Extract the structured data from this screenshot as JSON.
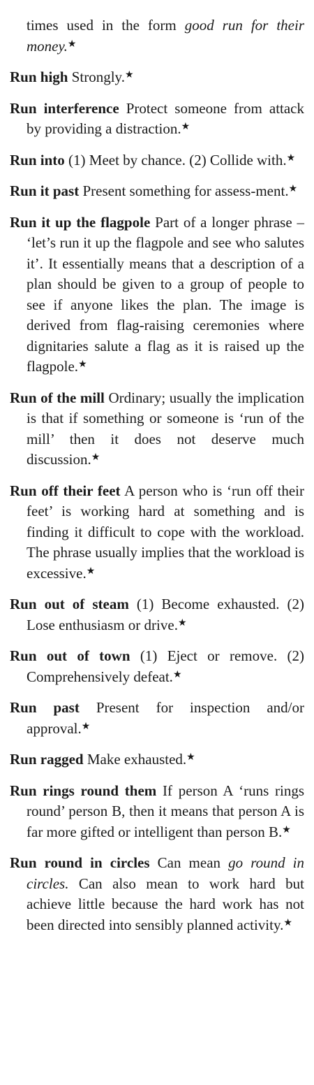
{
  "page": {
    "star": "★",
    "continuation": {
      "pre": "",
      "em": "times used in the form good run for their money.",
      "post": ""
    },
    "entries": [
      {
        "term": "Run high",
        "def": "Strongly."
      },
      {
        "term": "Run interference",
        "def": "Protect someone from attack by providing a distraction."
      },
      {
        "term": "Run into",
        "def": "(1) Meet by chance. (2) Collide with."
      },
      {
        "term": "Run it past",
        "def": "Present something for assess-ment."
      },
      {
        "term": "Run it up the flagpole",
        "def": "Part of a longer phrase – ‘let’s run it up the flagpole and see who salutes it’. It essentially means that a description of a plan should be given to a group of people to see if anyone likes the plan. The image is derived from flag-raising ceremonies where dignitaries salute a flag as it is raised up the flagpole."
      },
      {
        "term": "Run of the mill",
        "def": "Ordinary; usually the implication is that if something or someone is ‘run of the mill’ then it does not deserve much discussion."
      },
      {
        "term": "Run off their feet",
        "def": "A person who is ‘run off their feet’ is working hard at something and is finding it difficult to cope with the workload. The phrase usually implies that the workload is excessive."
      },
      {
        "term": "Run out of steam",
        "def": "(1) Become exhausted. (2) Lose enthusiasm or drive."
      },
      {
        "term": "Run out of town",
        "def": "(1) Eject or remove. (2) Comprehensively defeat."
      },
      {
        "term": "Run past",
        "def": "Present for inspection and/or approval."
      },
      {
        "term": "Run ragged",
        "def": "Make exhausted."
      },
      {
        "term": "Run rings round them",
        "def": "If person A ‘runs rings round’ person B, then it means that person A is far more gifted or intelligent than person B."
      }
    ],
    "last_entry": {
      "term": "Run round in circles",
      "pre": "Can mean",
      "em": "go round in circles.",
      "post": "Can also mean to work hard but achieve little because the hard work has not been directed into sensibly planned activity."
    }
  }
}
